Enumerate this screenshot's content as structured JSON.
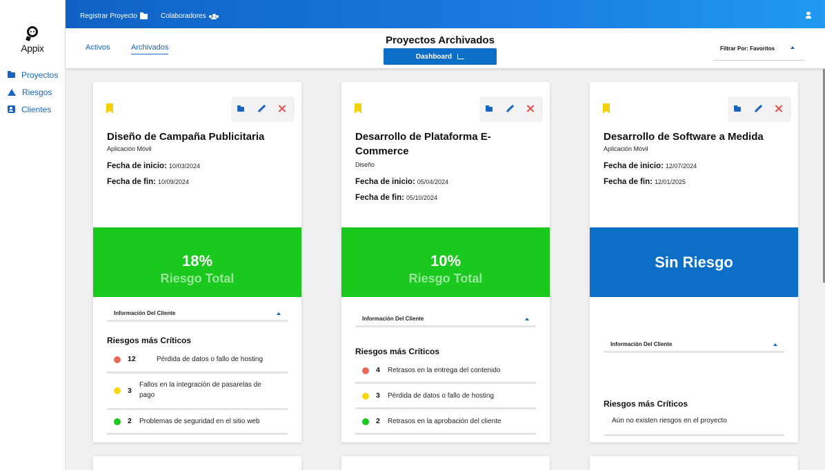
{
  "sidebar": {
    "logo": "Appix",
    "items": [
      {
        "label": "Proyectos",
        "icon": "folder-icon"
      },
      {
        "label": "Riesgos",
        "icon": "warning-icon"
      },
      {
        "label": "Clientes",
        "icon": "contact-card-icon"
      }
    ]
  },
  "topbar": {
    "register_label": "Registrar Proyecto",
    "collaborators_label": "Colaboradores",
    "user_icon": "user-icon"
  },
  "subheader": {
    "tabs": [
      {
        "label": "Activos",
        "active": false
      },
      {
        "label": "Archivados",
        "active": true
      }
    ],
    "title": "Proyectos Archivados",
    "dashboard_label": "Dashboard",
    "filter_label": "Filtrar Por: Favoritos"
  },
  "colors": {
    "primary": "#0d6ec8",
    "risk_green": "#1ac81e",
    "risk_blue": "#0d6ec8",
    "bookmark": "#f2d20b",
    "dot_red": "#e8685a",
    "dot_yellow": "#f4d90f",
    "dot_green": "#1ac81e"
  },
  "cards": [
    {
      "title": "Diseño de Campaña Publicitaria",
      "type": "Aplicación Móvil",
      "start_label": "Fecha de inicio:",
      "start": "10/03/2024",
      "end_label": "Fecha de fin:",
      "end": "10/09/2024",
      "risk_pct": "18%",
      "risk_label": "Riesgo Total",
      "client_info": "Información Del Cliente",
      "risks_title": "Riesgos más Críticos",
      "risks": [
        {
          "count": "12",
          "text": "Pérdida de datos o fallo de hosting",
          "level": "red"
        },
        {
          "count": "3",
          "text": "Fallos en la integración de pasarelas de pago",
          "level": "yellow"
        },
        {
          "count": "2",
          "text": "Problemas de seguridad en el sitio web",
          "level": "green"
        }
      ]
    },
    {
      "title": "Desarrollo de Plataforma E-Commerce",
      "type": "Diseño",
      "start_label": "Fecha de inicio:",
      "start": "05/04/2024",
      "end_label": "Fecha de fin:",
      "end": "05/10/2024",
      "risk_pct": "10%",
      "risk_label": "Riesgo Total",
      "client_info": "Información Del Cliente",
      "risks_title": "Riesgos más Críticos",
      "risks": [
        {
          "count": "4",
          "text": "Retrasos en la entrega del contenido",
          "level": "red"
        },
        {
          "count": "3",
          "text": "Pérdida de datos o fallo de hosting",
          "level": "yellow"
        },
        {
          "count": "2",
          "text": "Retrasos en la aprobación del cliente",
          "level": "green"
        }
      ]
    },
    {
      "title": "Desarrollo de Software a Medida",
      "type": "Aplicación Móvil",
      "start_label": "Fecha de inicio:",
      "start": "12/07/2024",
      "end_label": "Fecha de fin:",
      "end": "12/01/2025",
      "risk_single": "Sin Riesgo",
      "client_info": "Información Del Cliente",
      "risks_title": "Riesgos más Críticos",
      "empty_text": "Aún no existen riesgos en el proyecto"
    }
  ]
}
